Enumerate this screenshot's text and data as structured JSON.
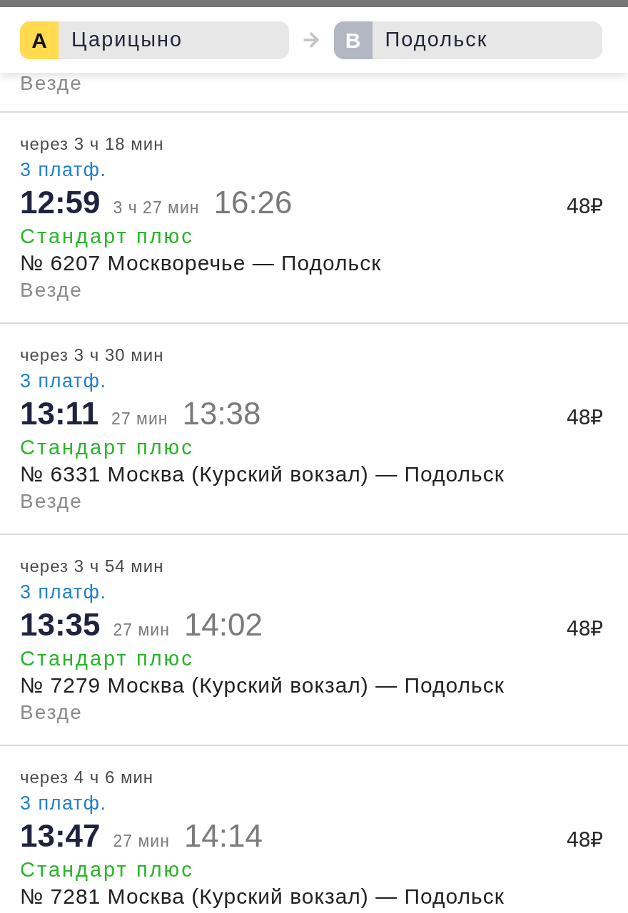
{
  "route": {
    "points": [
      {
        "letter": "A",
        "color": "#ffdb4d",
        "station": "Царицыно"
      },
      {
        "letter": "B",
        "color": "#b1b8c2",
        "station": "Подольск"
      }
    ]
  },
  "previous_trip": {
    "stops": "Везде"
  },
  "trips": [
    {
      "departs_in": "через 3 ч 18 мин",
      "platform": "3 платф.",
      "departure": "12:59",
      "duration": "3 ч 27 мин",
      "arrival": "16:26",
      "price": "48₽",
      "tariff": "Стандарт плюс",
      "train": "№ 6207 Москворечье — Подольск",
      "stops": "Везде"
    },
    {
      "departs_in": "через 3 ч 30 мин",
      "platform": "3 платф.",
      "departure": "13:11",
      "duration": "27 мин",
      "arrival": "13:38",
      "price": "48₽",
      "tariff": "Стандарт плюс",
      "train": "№ 6331 Москва (Курский вокзал) — Подольск",
      "stops": "Везде"
    },
    {
      "departs_in": "через 3 ч 54 мин",
      "platform": "3 платф.",
      "departure": "13:35",
      "duration": "27 мин",
      "arrival": "14:02",
      "price": "48₽",
      "tariff": "Стандарт плюс",
      "train": "№ 7279 Москва (Курский вокзал) — Подольск",
      "stops": "Везде"
    },
    {
      "departs_in": "через 4 ч 6 мин",
      "platform": "3 платф.",
      "departure": "13:47",
      "duration": "27 мин",
      "arrival": "14:14",
      "price": "48₽",
      "tariff": "Стандарт плюс",
      "train": "№ 7281 Москва (Курский вокзал) — Подольск"
    }
  ]
}
